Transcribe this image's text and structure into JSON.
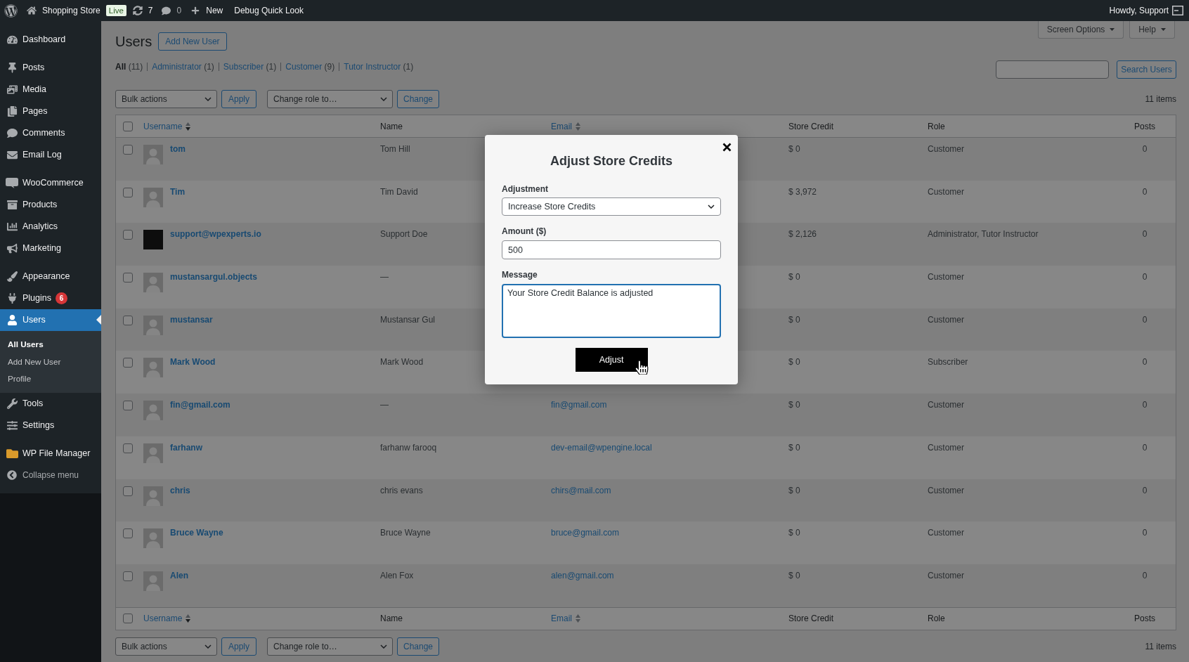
{
  "admin_bar": {
    "site_name": "Shopping Store",
    "site_badge": "Live",
    "updates_count": "7",
    "comments_count": "0",
    "new_label": "New",
    "debug_label": "Debug Quick Look",
    "greeting": "Howdy, Support"
  },
  "sidebar": {
    "groups": [
      [
        {
          "label": "Dashboard",
          "selected": false
        }
      ],
      [
        {
          "label": "Posts",
          "selected": false
        },
        {
          "label": "Media",
          "selected": false
        },
        {
          "label": "Pages",
          "selected": false
        },
        {
          "label": "Comments",
          "selected": false
        },
        {
          "label": "Email Log",
          "selected": false
        }
      ],
      [
        {
          "label": "WooCommerce",
          "selected": false
        },
        {
          "label": "Products",
          "selected": false
        },
        {
          "label": "Analytics",
          "selected": false
        },
        {
          "label": "Marketing",
          "selected": false
        }
      ],
      [
        {
          "label": "Appearance",
          "selected": false
        },
        {
          "label": "Plugins",
          "selected": false,
          "badge": "6"
        },
        {
          "label": "Users",
          "selected": true,
          "children": [
            {
              "label": "All Users",
              "selected": true
            },
            {
              "label": "Add New User",
              "selected": false
            },
            {
              "label": "Profile",
              "selected": false
            }
          ]
        },
        {
          "label": "Tools",
          "selected": false
        },
        {
          "label": "Settings",
          "selected": false
        }
      ],
      [
        {
          "label": "WP File Manager",
          "selected": false
        }
      ]
    ],
    "collapse_label": "Collapse menu"
  },
  "page": {
    "title": "Users",
    "add_new_label": "Add New User",
    "screen_options_label": "Screen Options",
    "help_label": "Help",
    "filters": [
      {
        "label": "All",
        "count": "(11)",
        "selected": true
      },
      {
        "label": "Administrator",
        "count": "(1)",
        "selected": false
      },
      {
        "label": "Subscriber",
        "count": "(1)",
        "selected": false
      },
      {
        "label": "Customer",
        "count": "(9)",
        "selected": false
      },
      {
        "label": "Tutor Instructor",
        "count": "(1)",
        "selected": false
      }
    ],
    "search_button_label": "Search Users"
  },
  "top_actions": {
    "bulk_select": "Bulk actions",
    "apply_label": "Apply",
    "role_select": "Change role to…",
    "change_label": "Change",
    "items_count": "11 items"
  },
  "table": {
    "select_all_checked": false,
    "header_columns": [
      {
        "label": "Username",
        "sortable": true,
        "sorted": true
      },
      {
        "label": "Name",
        "sortable": false
      },
      {
        "label": "Email",
        "sortable": true,
        "sorted": false
      },
      {
        "label": "Store Credit",
        "sortable": false
      },
      {
        "label": "Role",
        "sortable": false
      },
      {
        "label": "Posts",
        "sortable": false
      }
    ],
    "rows": [
      {
        "kind": "generic",
        "checked": false,
        "username": "tom",
        "name": "Tom Hill",
        "store_credit": "$ 0",
        "role": "Customer",
        "posts": "0"
      },
      {
        "kind": "generic",
        "checked": false,
        "username": "Tim",
        "name": "Tim David",
        "store_credit": "$ 3,972",
        "role": "Customer",
        "posts": "0"
      },
      {
        "kind": "custom",
        "checked": false,
        "username": "support@wpexperts.io",
        "name": "Support Doe",
        "store_credit": "$ 2,126",
        "role": "Administrator, Tutor Instructor",
        "posts": "0"
      },
      {
        "kind": "generic",
        "checked": false,
        "username": "mustansargul.objects",
        "name": "—",
        "store_credit": "$ 0",
        "role": "Customer",
        "posts": "0"
      },
      {
        "kind": "generic",
        "checked": false,
        "username": "mustansar",
        "name": "Mustansar Gul",
        "store_credit": "$ 0",
        "role": "Customer",
        "posts": "0"
      },
      {
        "kind": "generic",
        "checked": false,
        "username": "Mark Wood",
        "name": "Mark Wood",
        "store_credit": "$ 0",
        "role": "Subscriber",
        "posts": "0"
      },
      {
        "kind": "generic",
        "checked": false,
        "username": "fin@gmail.com",
        "name": "—",
        "email": "fin@gmail.com",
        "store_credit": "$ 0",
        "role": "Customer",
        "posts": "0"
      },
      {
        "kind": "generic",
        "checked": false,
        "username": "farhanw",
        "name": "farhanw farooq",
        "email": "dev-email@wpengine.local",
        "store_credit": "$ 0",
        "role": "Customer",
        "posts": "0"
      },
      {
        "kind": "generic",
        "checked": false,
        "username": "chris",
        "name": "chris evans",
        "email": "chirs@mail.com",
        "store_credit": "$ 0",
        "role": "Customer",
        "posts": "0"
      },
      {
        "kind": "generic",
        "checked": false,
        "username": "Bruce Wayne",
        "name": "Bruce Wayne",
        "email": "bruce@gmail.com",
        "store_credit": "$ 0",
        "role": "Customer",
        "posts": "0"
      },
      {
        "kind": "generic",
        "checked": false,
        "username": "Alen",
        "name": "Alen Fox",
        "email": "alen@gmail.com",
        "store_credit": "$ 0",
        "role": "Customer",
        "posts": "0"
      }
    ],
    "footer_select_all_checked": false,
    "footer_columns": [
      {
        "label": "Username",
        "sortable": true,
        "sorted": true
      },
      {
        "label": "Name",
        "sortable": false
      },
      {
        "label": "Email",
        "sortable": true,
        "sorted": false
      },
      {
        "label": "Store Credit",
        "sortable": false
      },
      {
        "label": "Role",
        "sortable": false
      },
      {
        "label": "Posts",
        "sortable": false
      }
    ]
  },
  "bottom_actions": {
    "bulk_select": "Bulk actions",
    "apply_label": "Apply",
    "role_select": "Change role to…",
    "change_label": "Change",
    "items_count": "11 items"
  },
  "modal": {
    "title": "Adjust Store Credits",
    "fields": [
      {
        "kind": "select",
        "label": "Adjustment",
        "value": "Increase Store Credits",
        "focused": false
      },
      {
        "kind": "input",
        "label": "Amount ($)",
        "value": "500",
        "focused": false
      },
      {
        "kind": "textarea",
        "label": "Message",
        "value": "Your Store Credit Balance is adjusted",
        "focused": true
      }
    ],
    "submit_label": "Adjust"
  }
}
